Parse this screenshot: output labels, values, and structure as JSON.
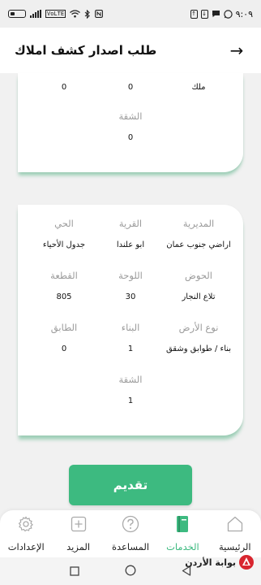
{
  "status_bar": {
    "time": "٩:٠٩",
    "volte": "VoLTE"
  },
  "header": {
    "title": "طلب اصدار كشف املاك",
    "back_arrow": "→"
  },
  "card_top": {
    "row1": {
      "right": "ملك",
      "middle": "0",
      "left": "0"
    },
    "apartment_label": "الشقة",
    "apartment_value": "0"
  },
  "card_bottom": {
    "directorate_label": "المديرية",
    "directorate_value": "اراضي جنوب عمان",
    "village_label": "القرية",
    "village_value": "ابو علندا",
    "neighborhood_label": "الحي",
    "neighborhood_value": "جدول الأحياء",
    "basin_label": "الحوض",
    "basin_value": "تلاع النجار",
    "plate_label": "اللوحة",
    "plate_value": "30",
    "parcel_label": "القطعة",
    "parcel_value": "805",
    "land_type_label": "نوع الأرض",
    "land_type_value": "بناء / طوابق وشقق",
    "building_label": "البناء",
    "building_value": "1",
    "floor_label": "الطابق",
    "floor_value": "0",
    "apartment_label": "الشقة",
    "apartment_value": "1"
  },
  "submit_label": "تقديم",
  "nav": {
    "items": [
      {
        "label": "الإعدادات",
        "icon": "gear-icon"
      },
      {
        "label": "المزيد",
        "icon": "plus-square-icon"
      },
      {
        "label": "المساعدة",
        "icon": "help-icon"
      },
      {
        "label": "الخدمات",
        "icon": "services-icon"
      },
      {
        "label": "الرئيسية",
        "icon": "home-icon"
      }
    ],
    "active_index": 3
  },
  "watermark": "بوابة الأردن",
  "colors": {
    "accent": "#3dba80",
    "muted_label": "#9b9b9b",
    "background": "#f1f1f1"
  }
}
